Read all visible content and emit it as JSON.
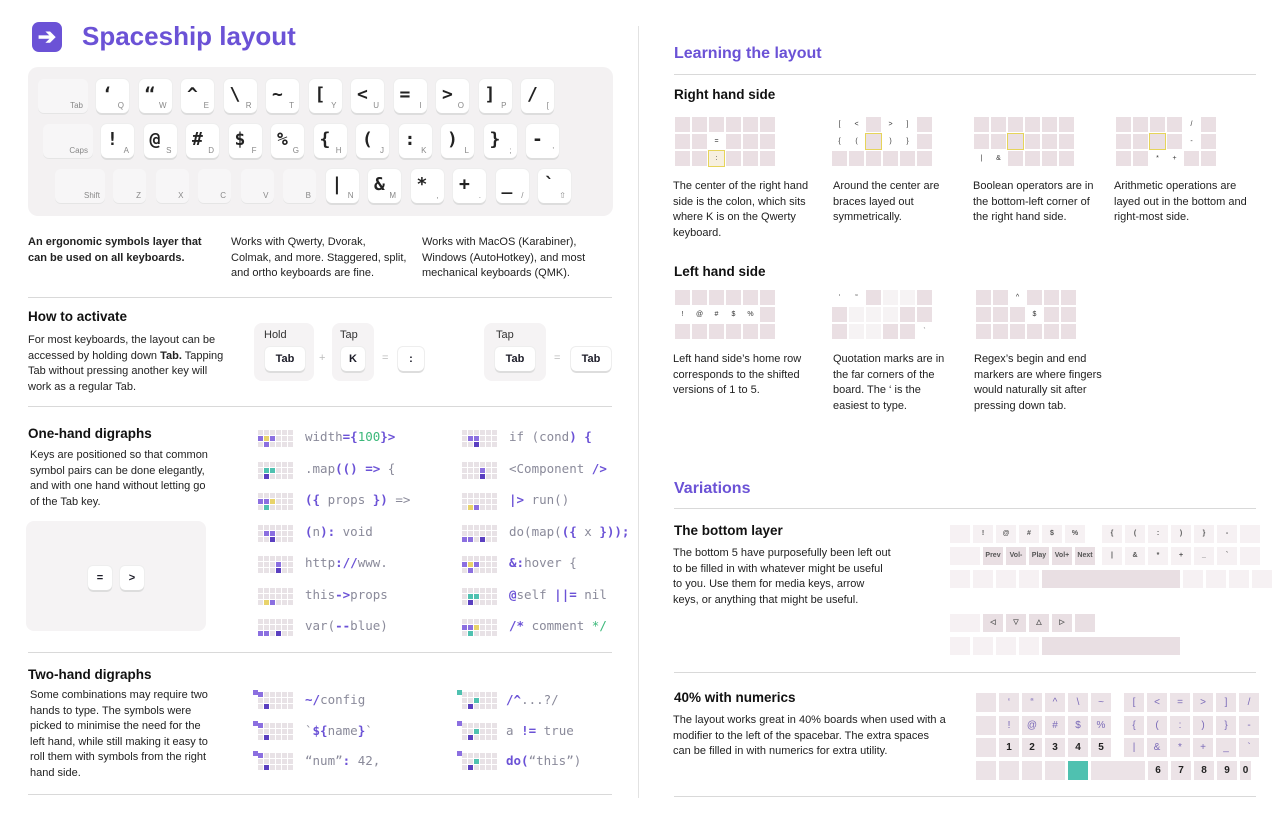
{
  "header": {
    "title": "Spaceship layout",
    "logo_icon": "arrow-right-icon"
  },
  "keyboard": {
    "row1": [
      {
        "m": "",
        "s": "Tab"
      },
      {
        "m": "‘",
        "s": "Q"
      },
      {
        "m": "“",
        "s": "W"
      },
      {
        "m": "^",
        "s": "E"
      },
      {
        "m": "\\",
        "s": "R"
      },
      {
        "m": "~",
        "s": "T"
      },
      {
        "m": "[",
        "s": "Y"
      },
      {
        "m": "<",
        "s": "U"
      },
      {
        "m": "=",
        "s": "I"
      },
      {
        "m": ">",
        "s": "O"
      },
      {
        "m": "]",
        "s": "P"
      },
      {
        "m": "/",
        "s": "["
      }
    ],
    "row2": [
      {
        "m": "",
        "s": "Caps"
      },
      {
        "m": "!",
        "s": "A"
      },
      {
        "m": "@",
        "s": "S"
      },
      {
        "m": "#",
        "s": "D"
      },
      {
        "m": "$",
        "s": "F"
      },
      {
        "m": "%",
        "s": "G"
      },
      {
        "m": "{",
        "s": "H"
      },
      {
        "m": "(",
        "s": "J"
      },
      {
        "m": ":",
        "s": "K"
      },
      {
        "m": ")",
        "s": "L"
      },
      {
        "m": "}",
        "s": ";"
      },
      {
        "m": "-",
        "s": "'"
      }
    ],
    "row3": [
      {
        "m": "",
        "s": "Shift"
      },
      {
        "m": "",
        "s": "Z"
      },
      {
        "m": "",
        "s": "X"
      },
      {
        "m": "",
        "s": "C"
      },
      {
        "m": "",
        "s": "V"
      },
      {
        "m": "",
        "s": "B"
      },
      {
        "m": "|",
        "s": "N"
      },
      {
        "m": "&",
        "s": "M"
      },
      {
        "m": "*",
        "s": ","
      },
      {
        "m": "+",
        "s": "."
      },
      {
        "m": "_",
        "s": "/"
      },
      {
        "m": "`",
        "s": "⇧"
      }
    ]
  },
  "intro": {
    "col1": "An ergonomic symbols layer that can be used on all keyboards.",
    "col2": "Works with Qwerty, Dvorak, Colmak, and more. Staggered, split, and ortho keyboards are fine.",
    "col3": "Works with MacOS (Karabiner), Windows (AutoHotkey), and most mechanical keyboards (QMK)."
  },
  "activate": {
    "title": "How to activate",
    "text_a": "For most keyboards, the layout can be accessed by holding down ",
    "text_b": "Tab.",
    "text_c": " Tapping Tab without pressing another key will work as a regular Tab.",
    "hold": "Hold",
    "tap": "Tap",
    "tab": "Tab",
    "k": "K",
    "colon": ":",
    "plus": "+",
    "eq": "="
  },
  "onehand": {
    "title": "One-hand digraphs",
    "text": "Keys are positioned so that common symbol pairs can be done elegantly, and with one hand without letting go of the Tab key.",
    "demo_eq": "=",
    "demo_gt": ">",
    "left": [
      [
        [
          "width",
          ""
        ],
        [
          "={",
          "k"
        ],
        [
          "100",
          "g"
        ],
        [
          "}>",
          "k"
        ]
      ],
      [
        [
          ".map",
          ""
        ],
        [
          "(() =>",
          "k"
        ],
        [
          " {",
          ""
        ]
      ],
      [
        [
          "({",
          "k"
        ],
        [
          " props ",
          ""
        ],
        [
          "})",
          "k"
        ],
        [
          " =>",
          ""
        ]
      ],
      [
        [
          "(",
          "k"
        ],
        [
          "n",
          ""
        ],
        [
          "):",
          "k"
        ],
        [
          " void",
          ""
        ]
      ],
      [
        [
          "http",
          ""
        ],
        [
          "://",
          "k"
        ],
        [
          "www.",
          ""
        ]
      ],
      [
        [
          "this",
          ""
        ],
        [
          "->",
          "k"
        ],
        [
          "props",
          ""
        ]
      ],
      [
        [
          "var(",
          ""
        ],
        [
          "--",
          "k"
        ],
        [
          "blue)",
          ""
        ]
      ]
    ],
    "right": [
      [
        [
          "if (",
          ""
        ],
        [
          "cond",
          ""
        ],
        [
          ") {",
          "k"
        ]
      ],
      [
        [
          "<Component ",
          ""
        ],
        [
          "/>",
          "k"
        ]
      ],
      [
        [
          "|>",
          "k"
        ],
        [
          " run()",
          ""
        ]
      ],
      [
        [
          "do(map(",
          ""
        ],
        [
          "({",
          "k"
        ],
        [
          " x ",
          ""
        ],
        [
          "}));",
          "k"
        ]
      ],
      [
        [
          "&:",
          "k"
        ],
        [
          "hover {",
          ""
        ]
      ],
      [
        [
          "@",
          "k"
        ],
        [
          "self ",
          ""
        ],
        [
          "||=",
          "k"
        ],
        [
          " nil",
          ""
        ]
      ],
      [
        [
          "/*",
          "k"
        ],
        [
          " comment ",
          ""
        ],
        [
          "*/",
          "g"
        ]
      ]
    ]
  },
  "twohand": {
    "title": "Two-hand digraphs",
    "text": "Some combinations may require two hands to type. The symbols were picked to minimise the need for the left hand, while still making it easy to roll them with symbols from the right hand side.",
    "left": [
      [
        [
          "~/",
          "k"
        ],
        [
          "config",
          ""
        ]
      ],
      [
        [
          "`",
          ""
        ],
        [
          "${",
          "k"
        ],
        [
          "name",
          ""
        ],
        [
          "}",
          "k"
        ],
        [
          "`",
          ""
        ]
      ],
      [
        [
          "“num”",
          ""
        ],
        [
          ":",
          "k"
        ],
        [
          " 42,",
          ""
        ]
      ]
    ],
    "right": [
      [
        [
          "/^",
          "k"
        ],
        [
          "...?/",
          ""
        ]
      ],
      [
        [
          "a ",
          ""
        ],
        [
          "!=",
          "k"
        ],
        [
          " true",
          ""
        ]
      ],
      [
        [
          "do(",
          "k"
        ],
        [
          "“this”)",
          ""
        ]
      ]
    ]
  },
  "learning": {
    "title": "Learning the layout",
    "rh_title": "Right hand side",
    "rh": [
      "The center of the right hand side is the colon, which sits where K is on the Qwerty keyboard.",
      "Around the center are braces layed out symmetrically.",
      "Boolean operators are in the bottom-left corner of the right hand side.",
      "Arithmetic operations are layed out in the bottom and right-most side."
    ],
    "lh_title": "Left hand side",
    "lh": [
      "Left hand side’s home row corresponds to the shifted versions of 1 to 5.",
      "Quotation marks are in the far corners of the board. The ‘ is the easiest to type.",
      "Regex’s begin and end markers are where fingers would naturally sit after pressing down tab."
    ]
  },
  "variations": {
    "title": "Variations",
    "bottom_title": "The bottom layer",
    "bottom_text": "The bottom 5 have purposefully been left out to be filled in with whatever might be useful to you. Use them for media keys, arrow keys, or anything that might be useful.",
    "media": [
      "Prev",
      "Vol-",
      "Play",
      "Vol+",
      "Next"
    ],
    "arrows": [
      "◁",
      "▽",
      "△",
      "▷"
    ],
    "num_title": "40% with numerics",
    "num_text": "The layout works great in 40% boards when used with a modifier to the left of the spacebar. The extra spaces can be filled in with numerics for extra utility.",
    "nums_left": [
      "1",
      "2",
      "3",
      "4",
      "5"
    ],
    "nums_right": [
      "6",
      "7",
      "8",
      "9",
      "0"
    ],
    "accent": "#4fc1b0"
  }
}
